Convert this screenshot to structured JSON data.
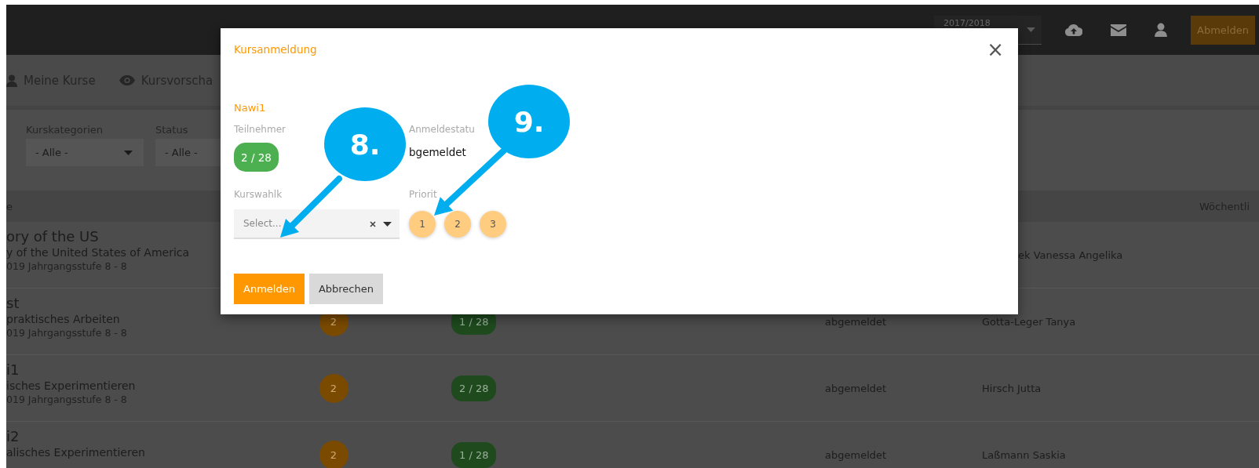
{
  "top_bar": {
    "school_year": "2017/2018",
    "logout_button": "Abmelden"
  },
  "nav": [
    {
      "label": "Meine Kurse",
      "kind": "user"
    },
    {
      "label": "Kursvorscha",
      "kind": "eye"
    }
  ],
  "filters": [
    {
      "label": "Kurskategorien",
      "value": "- Alle -"
    },
    {
      "label": "Status",
      "value": "- Alle -"
    }
  ],
  "table": {
    "column_1": "e",
    "column_7": "Wöchentli",
    "rows": [
      {
        "title": "ory of the US",
        "subtitle": "y of the United States of America",
        "details": "019 Jahrgangsstufe 8 - 8",
        "teacher": "ek Vanessa Angelika"
      },
      {
        "title": "st",
        "subtitle": "praktisches Arbeiten",
        "details": "019 Jahrgangsstufe 8 - 8",
        "priority": "2",
        "participants": "1 / 28",
        "status": "abgemeldet",
        "teacher": "Gotta-Leger Tanya"
      },
      {
        "title": "i1",
        "subtitle": "isches Experimentieren",
        "details": "019 Jahrgangsstufe 8 - 8",
        "priority": "2",
        "participants": "2 / 28",
        "status": "abgemeldet",
        "teacher": "Hirsch Jutta"
      },
      {
        "title": "i2",
        "subtitle": "alisches Experimentieren",
        "priority": "2",
        "participants": "1 / 28",
        "status": "abgemeldet",
        "teacher": "Laßmann Saskia"
      }
    ]
  },
  "modal": {
    "title": "Kursanmeldung",
    "close": "×",
    "course": "Nawi1",
    "participants_label": "Teilnehmer",
    "participants": "2 / 28",
    "status_label": "Anmeldestatu",
    "status": "bgemeldet",
    "category_label": "Kurswahlk",
    "category": {
      "placeholder": "Select..."
    },
    "priority_label": "Priorit",
    "priorities": [
      {
        "label": "1",
        "selected": false
      },
      {
        "label": "2",
        "selected": false
      },
      {
        "label": "3",
        "selected": false
      }
    ],
    "buttons": [
      {
        "label": "Anmelden",
        "kind": "primary"
      },
      {
        "label": "Abbrechen",
        "kind": "secondary"
      }
    ]
  },
  "callouts": [
    {
      "label": "8."
    },
    {
      "label": "9."
    }
  ]
}
